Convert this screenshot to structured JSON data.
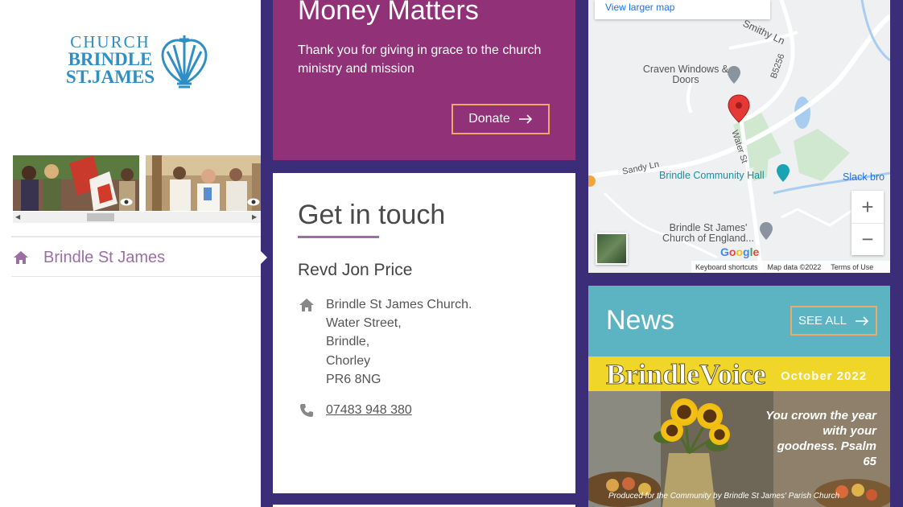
{
  "logo": {
    "line1": "CHURCH",
    "line2": "BRINDLE",
    "line3": "ST.JAMES",
    "color": "#2f8fc4"
  },
  "gallery": {
    "items": [
      "photo-people-flags",
      "photo-church-choir"
    ],
    "scroll_left": "◀",
    "scroll_right": "▶"
  },
  "nav": {
    "home_label": "Brindle St James",
    "icon": "home-icon"
  },
  "money": {
    "title": "Money Matters",
    "text": "Thank you for giving in grace to the church ministry and mission",
    "donate_label": "Donate",
    "bg": "#913178"
  },
  "contact": {
    "title": "Get in touch",
    "name": "Revd Jon Price",
    "address": [
      "Brindle St James Church.",
      "Water Street,",
      "Brindle,",
      "Chorley",
      "PR6 8NG"
    ],
    "phone": "07483 948 380"
  },
  "map": {
    "larger_link": "View larger map",
    "labels": {
      "smithy": "Smithy Ln",
      "craven": "Craven Windows & Doors",
      "b5256": "B5256",
      "water": "Water St",
      "sandy": "Sandy Ln",
      "hall": "Brindle Community Hall",
      "slack": "Slack bro",
      "church": "Brindle St James' Church of England..."
    },
    "zoom_in": "+",
    "zoom_out": "−",
    "google": "Google",
    "footer": [
      "Keyboard shortcuts",
      "Map data ©2022",
      "Terms of Use"
    ]
  },
  "news": {
    "title": "News",
    "see_all": "SEE ALL",
    "bg": "#5cb4c2",
    "newsletter": {
      "name": "BrindleVoice",
      "date": "October 2022",
      "verse": "You crown the year with your goodness. Psalm 65",
      "footer": "Produced for the Community by Brindle St James' Parish Church"
    }
  }
}
